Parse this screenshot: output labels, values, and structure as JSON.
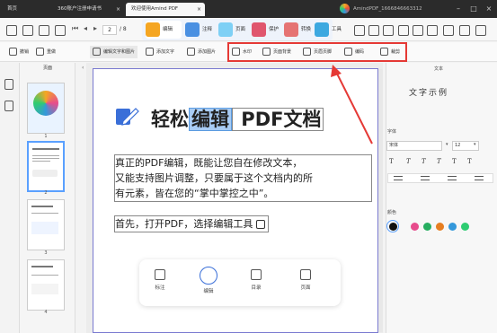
{
  "titlebar": {
    "tabs": [
      {
        "label": "首页",
        "active": false
      },
      {
        "label": "360账户注册申请书",
        "active": false
      },
      {
        "label": "欢迎使用Amind PDF",
        "active": true
      }
    ],
    "account": "AmindPDF_1666846663312"
  },
  "toolbar": {
    "page_current": "2",
    "page_total": "/ 8",
    "modes": [
      {
        "label": "编辑",
        "color": "#f5a623"
      },
      {
        "label": "注释",
        "color": "#4a90e2"
      },
      {
        "label": "页面",
        "color": "#7ed0f5"
      },
      {
        "label": "保护",
        "color": "#e0566e"
      },
      {
        "label": "转换",
        "color": "#e57373"
      },
      {
        "label": "工具",
        "color": "#3ca8e0"
      }
    ]
  },
  "toolbar2": {
    "left": [
      "撤销",
      "重做"
    ],
    "edit": [
      "编辑文字和图片",
      "添加文字",
      "添加图片"
    ],
    "highlighted": [
      "水印",
      "页面背景",
      "页眉页脚",
      "编码",
      "裁剪"
    ]
  },
  "sidebar": {
    "thumbs_title": "页面",
    "pages": [
      "1",
      "2",
      "3",
      "4"
    ]
  },
  "document": {
    "title_pre": "轻松",
    "title_hl": "编辑",
    "title_post": " PDF文档",
    "paragraph1_lines": [
      "真正的PDF编辑，既能让您自在修改文本，",
      "又能支持图片调整，只要属于这个文档内的所",
      "有元素，皆在您的“掌中掌控之中”。"
    ],
    "paragraph2": "首先，打开PDF，选择编辑工具"
  },
  "dock": {
    "items": [
      "标注",
      "编辑",
      "目录",
      "页面"
    ]
  },
  "rightpanel": {
    "title": "文本",
    "sample": "文字示例",
    "font_label": "字体",
    "font_value": "宋体",
    "size_value": "12",
    "color_label": "颜色",
    "colors": [
      "#111111",
      "#e74c8c",
      "#27ae60",
      "#e67e22",
      "#3498db",
      "#2ecc71"
    ]
  }
}
